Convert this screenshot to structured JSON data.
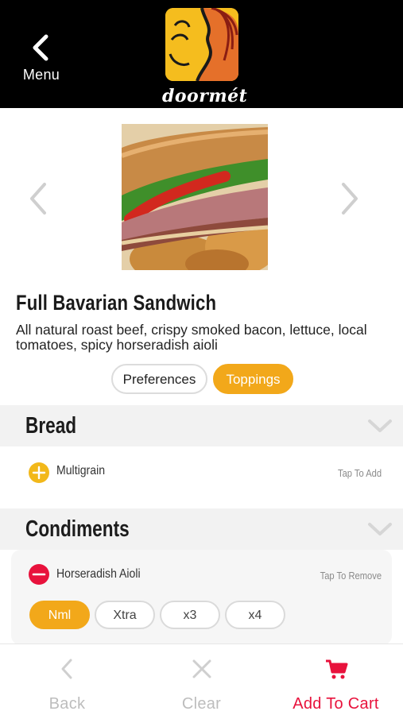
{
  "header": {
    "menu_label": "Menu",
    "brand_name": "doormét"
  },
  "product": {
    "title": "Full Bavarian Sandwich",
    "description": "All natural roast beef, crispy smoked bacon, lettuce, local tomatoes, spicy horseradish aioli"
  },
  "tabs": {
    "preferences_label": "Preferences",
    "toppings_label": "Toppings",
    "active": "Toppings"
  },
  "sections": [
    {
      "name": "Bread",
      "options": [
        {
          "name": "Multigrain",
          "action_hint": "Tap To Add",
          "state": "add"
        }
      ]
    },
    {
      "name": "Condiments",
      "options": [
        {
          "name": "Horseradish Aioli",
          "action_hint": "Tap To Remove",
          "state": "remove",
          "quantities": [
            "Nml",
            "Xtra",
            "x3",
            "x4"
          ],
          "selected_quantity": "Nml"
        }
      ]
    }
  ],
  "bottom_bar": {
    "back_label": "Back",
    "clear_label": "Clear",
    "add_to_cart_label": "Add To Cart"
  },
  "colors": {
    "accent": "#f2a81a",
    "remove": "#e8123c",
    "cart": "#e8123c",
    "header_bg": "#000000",
    "section_bg": "#f2f2f2",
    "muted": "#bdbdbd"
  },
  "icons": {
    "menu": "chevron-left-icon",
    "prev_image": "chevron-left-icon",
    "next_image": "chevron-right-icon",
    "section_toggle": "chevron-down-icon",
    "add": "plus-circle-icon",
    "remove": "minus-circle-icon",
    "back": "chevron-left-icon",
    "clear": "close-icon",
    "cart": "cart-icon"
  }
}
